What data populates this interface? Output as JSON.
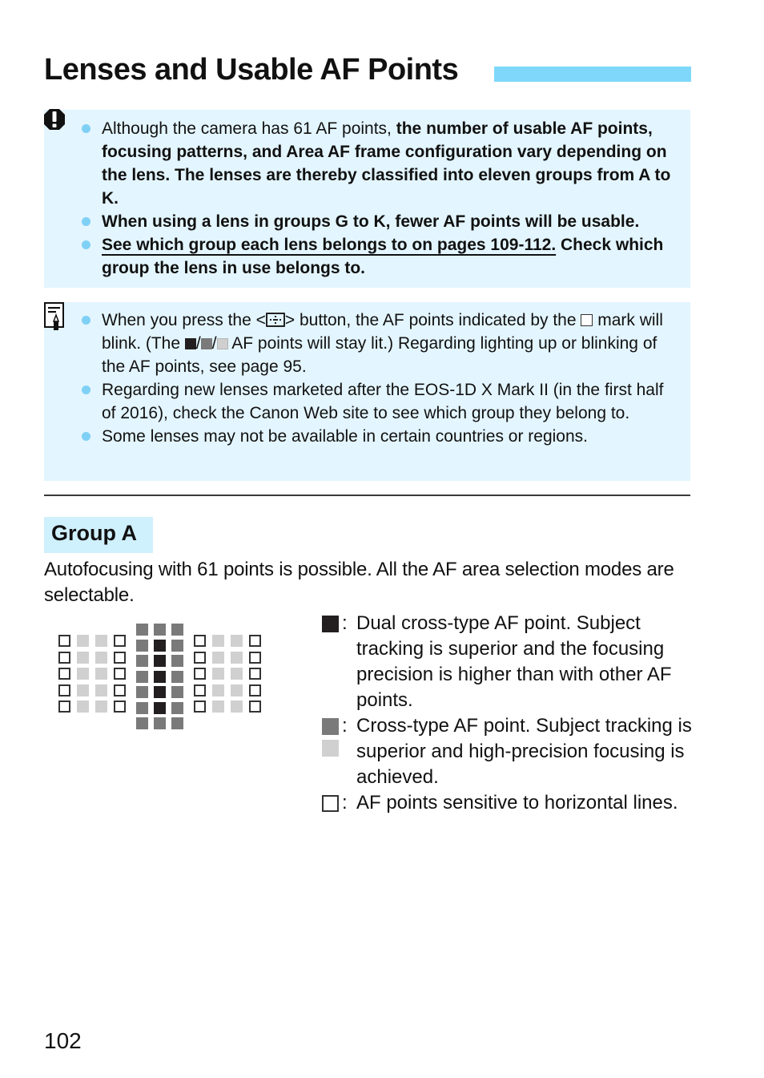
{
  "header": {
    "title": "Lenses and Usable AF Points",
    "accent_color": "#7fd8fb"
  },
  "caution_box": {
    "icon": "caution-exclamation-icon",
    "background": "#e3f5fe",
    "bullets": [
      {
        "normal": "Although the camera has 61 AF points, ",
        "bold": "the number of usable AF points, focusing patterns, and Area AF frame configuration vary depending on the lens. The lenses are thereby classified into eleven groups from A to K."
      },
      {
        "bold": "When using a lens in groups G to K, fewer AF points will be usable."
      },
      {
        "underlined_bold": "See which group each lens belongs to on pages 109-112.",
        "bold": " Check which group the lens in use belongs to."
      }
    ]
  },
  "memo_box": {
    "icon": "memo-pencil-icon",
    "background": "#e3f5fe",
    "bullets": [
      {
        "part1": "When you press the <",
        "button_icon": "af-point-selection-button-icon",
        "part2": "> button, the AF points indicated by the ",
        "mark_icon": "outline-square-icon",
        "part3": " mark will blink. (The ",
        "sep": "/",
        "part4": " AF points will stay lit.) Regarding lighting up or blinking of the AF points, see page 95."
      },
      {
        "text": "Regarding new lenses marketed after the EOS-1D X Mark II (in the first half of 2016), check the Canon Web site to see which group they belong to."
      },
      {
        "text": "Some lenses may not be available in certain countries or regions."
      }
    ]
  },
  "group": {
    "label": "Group A",
    "description": "Autofocusing with 61 points is possible. All the AF area selection modes are selectable.",
    "total_af_points": 61,
    "diagram": {
      "left_cluster": {
        "rows": 5,
        "pattern": [
          "outline",
          "light",
          "light",
          "outline"
        ]
      },
      "center_cluster": {
        "rows": [
          [
            "gray",
            "gray",
            "gray"
          ],
          [
            "gray",
            "black",
            "gray"
          ],
          [
            "gray",
            "black",
            "gray"
          ],
          [
            "gray",
            "black",
            "gray"
          ],
          [
            "gray",
            "black",
            "gray"
          ],
          [
            "gray",
            "black",
            "gray"
          ],
          [
            "gray",
            "gray",
            "gray"
          ]
        ]
      },
      "right_cluster": {
        "rows": 5,
        "pattern": [
          "outline",
          "light",
          "light",
          "outline"
        ]
      }
    },
    "legend": [
      {
        "swatches": [
          "black"
        ],
        "colon": ":",
        "text": "Dual cross-type AF point. Subject tracking is superior and the focusing precision is higher than with other AF points."
      },
      {
        "swatches": [
          "gray",
          "light"
        ],
        "colon": ":",
        "text": "Cross-type AF point. Subject tracking is superior and high-precision focusing is achieved."
      },
      {
        "swatches": [
          "outline"
        ],
        "colon": ":",
        "text": "AF points sensitive to horizontal lines."
      }
    ],
    "colors": {
      "black": "#231f20",
      "gray": "#7a7a7a",
      "light": "#d0d0d0",
      "outline_border": "#333333"
    }
  },
  "footer": {
    "page_number": "102"
  }
}
